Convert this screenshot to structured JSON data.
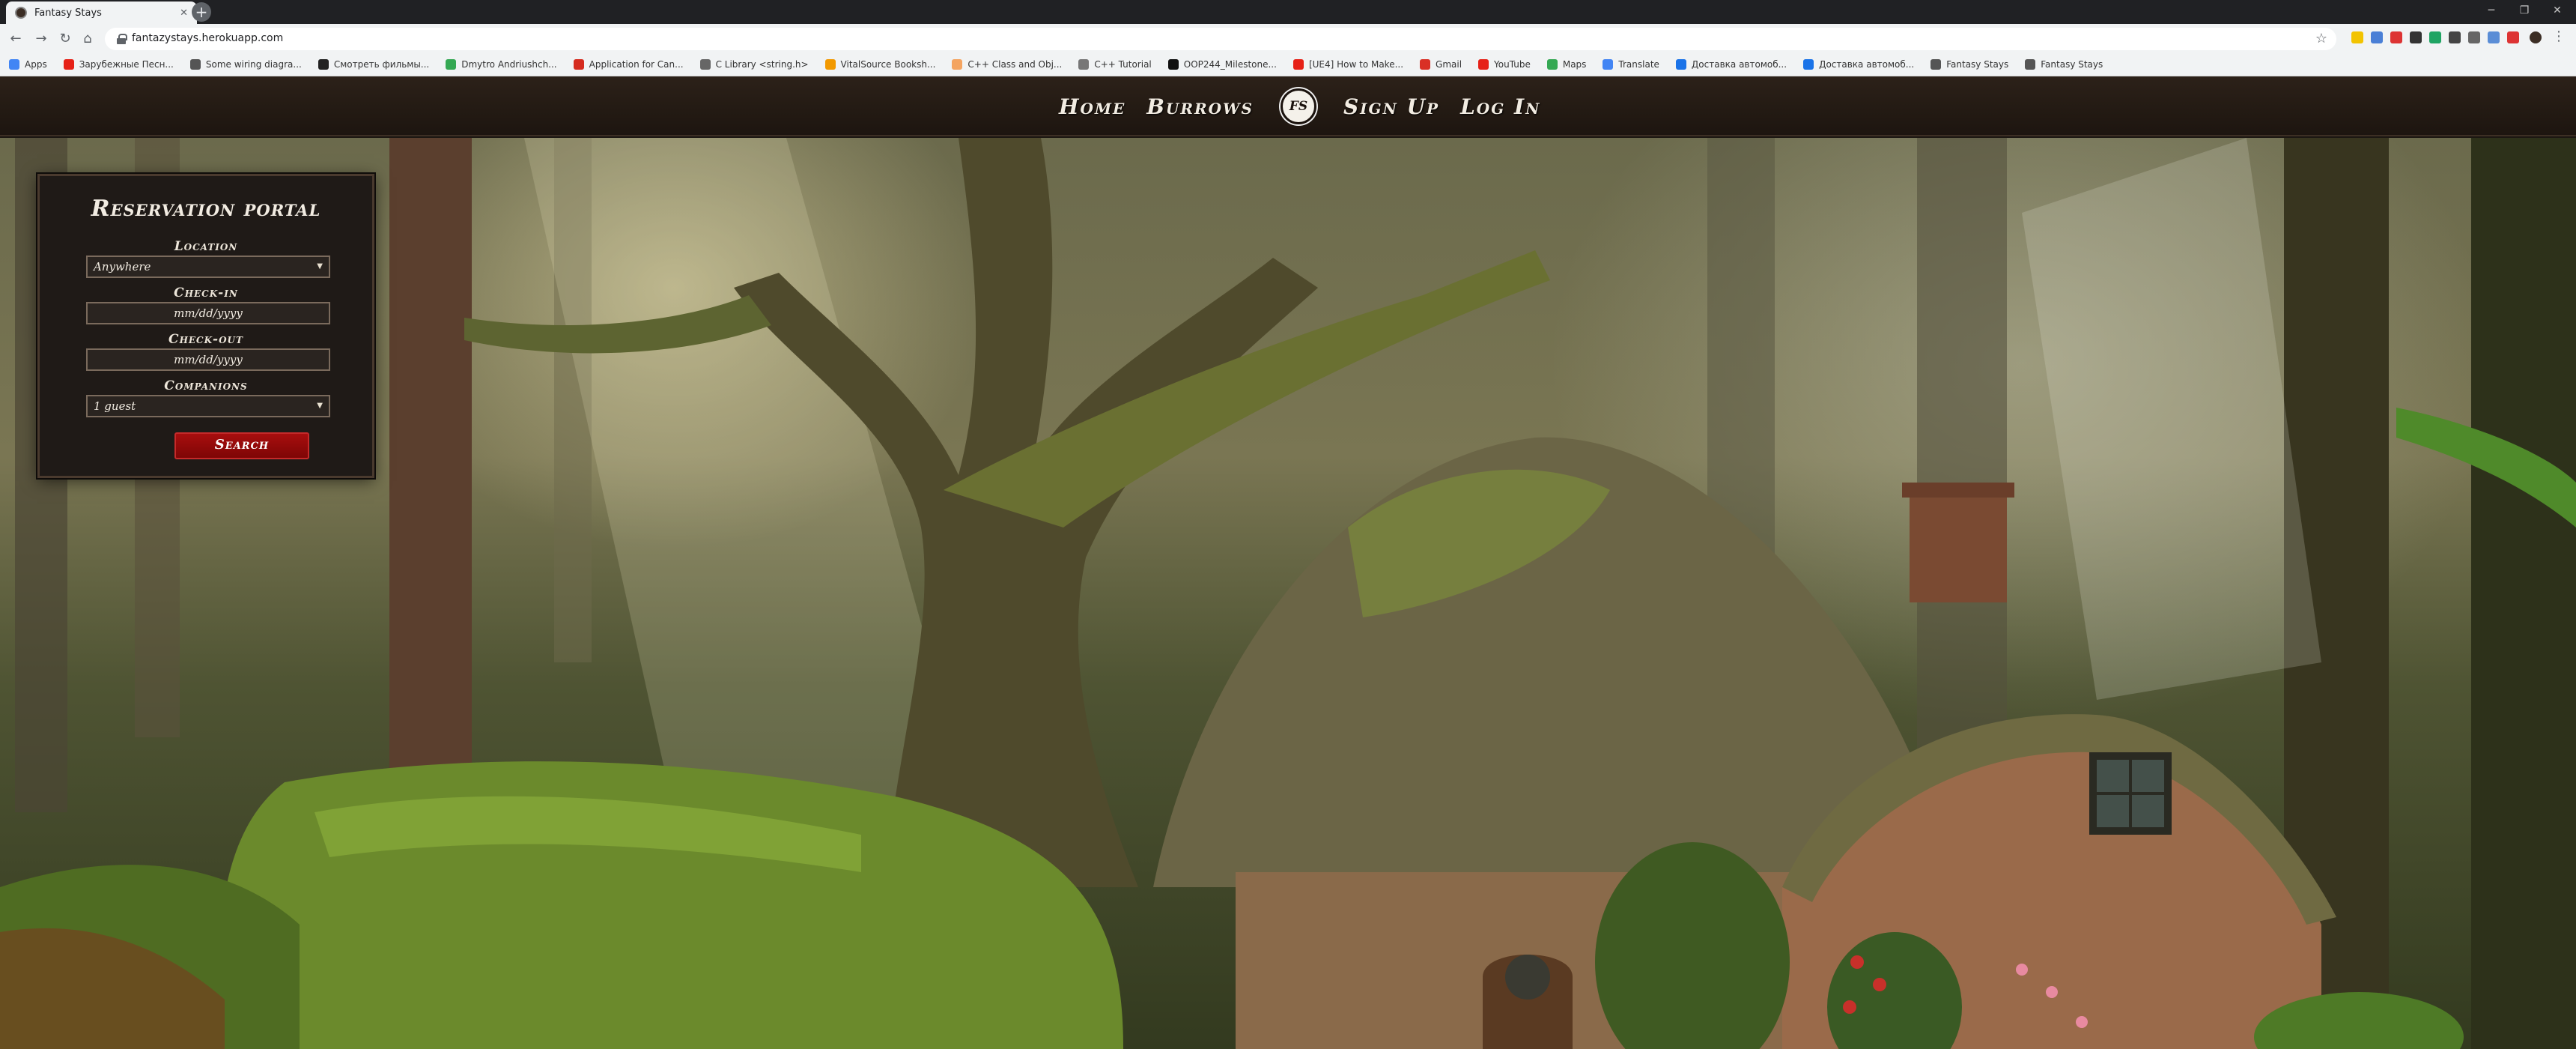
{
  "browser": {
    "tab_title": "Fantasy Stays",
    "url": "fantazystays.herokuapp.com",
    "bookmarks": [
      {
        "label": "Apps",
        "color": "#4285f4"
      },
      {
        "label": "Зарубежные Песн...",
        "color": "#e62117"
      },
      {
        "label": "Some wiring diagra...",
        "color": "#555555"
      },
      {
        "label": "Смотреть фильмы...",
        "color": "#222222"
      },
      {
        "label": "Dmytro Andriushch...",
        "color": "#34a853"
      },
      {
        "label": "Application for Can...",
        "color": "#d52b1e"
      },
      {
        "label": "C Library <string.h>",
        "color": "#666666"
      },
      {
        "label": "VitalSource Booksh...",
        "color": "#f29900"
      },
      {
        "label": "C++ Class and Obj...",
        "color": "#f4a460"
      },
      {
        "label": "C++ Tutorial",
        "color": "#777777"
      },
      {
        "label": "OOP244_Milestone...",
        "color": "#111111"
      },
      {
        "label": "[UE4] How to Make...",
        "color": "#e62117"
      },
      {
        "label": "Gmail",
        "color": "#d93025"
      },
      {
        "label": "YouTube",
        "color": "#e62117"
      },
      {
        "label": "Maps",
        "color": "#34a853"
      },
      {
        "label": "Translate",
        "color": "#4285f4"
      },
      {
        "label": "Доставка автомоб...",
        "color": "#1a73e8"
      },
      {
        "label": "Доставка автомоб...",
        "color": "#1a73e8"
      },
      {
        "label": "Fantasy Stays",
        "color": "#555555"
      },
      {
        "label": "Fantasy Stays",
        "color": "#555555"
      }
    ]
  },
  "nav": {
    "home": "Home",
    "burrows": "Burrows",
    "logo_text": "FS",
    "signup": "Sign Up",
    "login": "Log In"
  },
  "portal": {
    "title": "Reservation portal",
    "location_label": "Location",
    "location_value": "Anywhere",
    "checkin_label": "Check-in",
    "checkin_placeholder": "mm/dd/yyyy",
    "checkout_label": "Check-out",
    "checkout_placeholder": "mm/dd/yyyy",
    "companions_label": "Companions",
    "companions_value": "1 guest",
    "search_label": "Search"
  }
}
